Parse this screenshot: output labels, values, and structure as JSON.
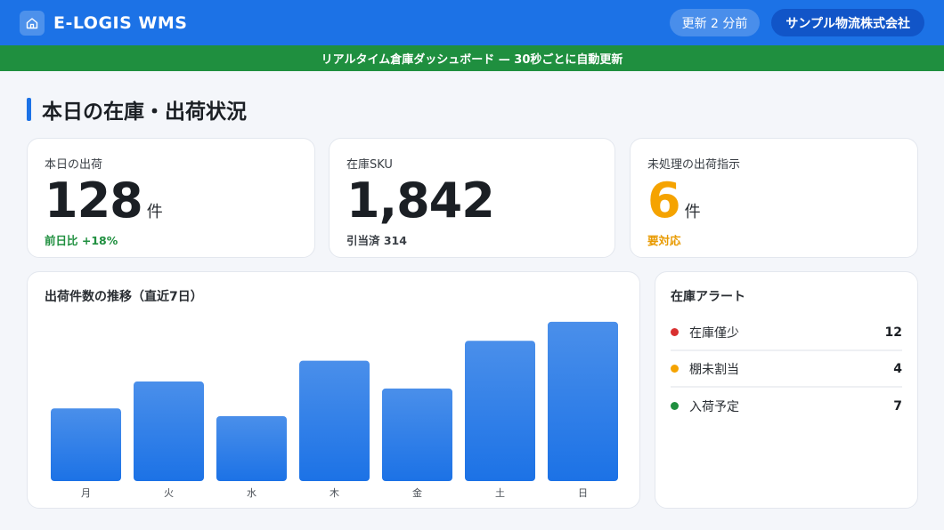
{
  "header": {
    "app_title": "E-LOGIS WMS",
    "update_status": "更新 2 分前",
    "company": "サンプル物流株式会社",
    "logo_icon": "home-icon",
    "brand_color": "#1c72e6"
  },
  "banner": {
    "text": "リアルタイム倉庫ダッシュボード — 30秒ごとに自動更新",
    "color": "#1f8f3f"
  },
  "section": {
    "title": "本日の在庫・出荷状況"
  },
  "kpis": [
    {
      "label": "本日の出荷",
      "value": "128",
      "unit": "件",
      "sub": "前日比 +18%",
      "value_color": "#1b1f24",
      "sub_color": "#1f8f3f"
    },
    {
      "label": "在庫SKU",
      "value": "1,842",
      "unit": "",
      "sub": "引当済 314",
      "value_color": "#1b1f24",
      "sub_color": "#3a3f45"
    },
    {
      "label": "未処理の出荷指示",
      "value": "6",
      "unit": "件",
      "sub": "要対応",
      "value_color": "#f5a300",
      "sub_color": "#e89a00"
    }
  ],
  "alerts": {
    "title": "在庫アラート",
    "items": [
      {
        "label": "在庫僅少",
        "count": "12",
        "color": "#d93030"
      },
      {
        "label": "棚未割当",
        "count": "4",
        "color": "#f5a300"
      },
      {
        "label": "入荷予定",
        "count": "7",
        "color": "#1f8f3f"
      }
    ]
  },
  "chart_data": {
    "type": "bar",
    "title": "出荷件数の推移（直近7日）",
    "categories": [
      "月",
      "火",
      "水",
      "木",
      "金",
      "土",
      "日"
    ],
    "values": [
      84,
      115,
      75,
      139,
      107,
      162,
      184
    ],
    "ylim": [
      0,
      190
    ],
    "xlabel": "",
    "ylabel": "",
    "grid": false,
    "bar_color": "#1c72e6"
  }
}
